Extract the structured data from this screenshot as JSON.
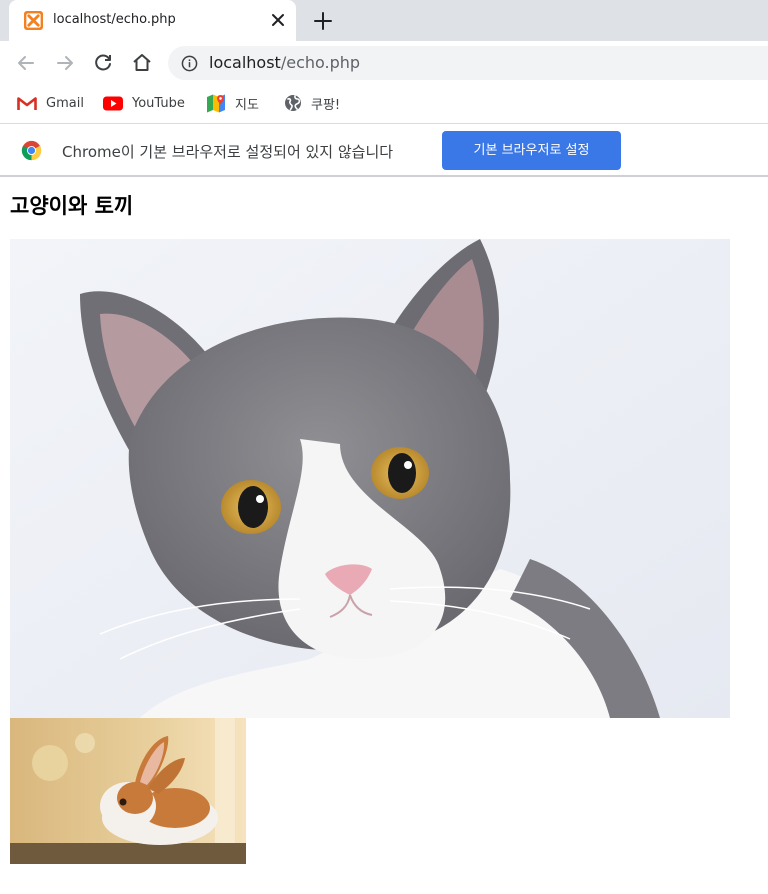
{
  "tab": {
    "title": "localhost/echo.php",
    "favicon": "xampp-icon"
  },
  "toolbar": {
    "url_host": "localhost",
    "url_path": "/echo.php"
  },
  "bookmarks": [
    {
      "label": "Gmail",
      "icon": "gmail-icon"
    },
    {
      "label": "YouTube",
      "icon": "youtube-icon"
    },
    {
      "label": "지도",
      "icon": "maps-icon"
    },
    {
      "label": "쿠팡!",
      "icon": "globe-icon"
    }
  ],
  "infobar": {
    "message": "Chrome이 기본 브라우저로 설정되어 있지 않습니다",
    "button_label": "기본 브라우저로 설정"
  },
  "page": {
    "heading": "고양이와 토끼",
    "images": [
      "cat-photo",
      "rabbit-photo"
    ]
  },
  "colors": {
    "tabstrip": "#dee1e6",
    "omnibox": "#f1f3f4",
    "accent_button": "#3b78e7"
  }
}
